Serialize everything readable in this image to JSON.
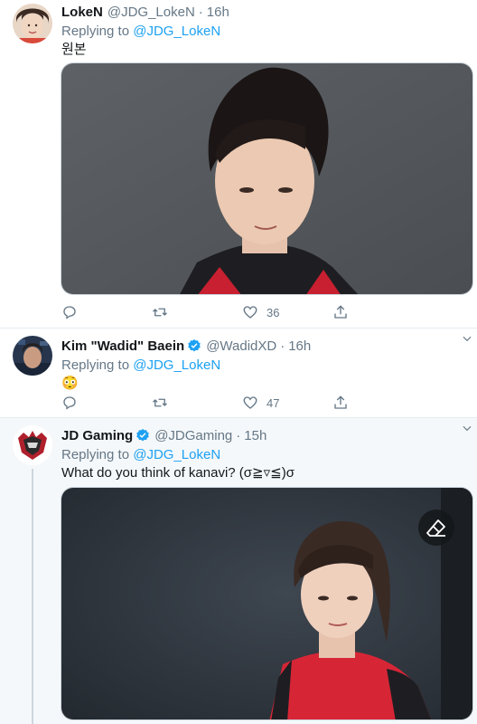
{
  "tweets": [
    {
      "display_name": "LokeN",
      "handle": "@JDG_LokeN",
      "time": "16h",
      "replying_label": "Replying to ",
      "replying_to": "@JDG_LokeN",
      "text": "원본",
      "verified": false,
      "actions": {
        "reply_count": "",
        "retweet_count": "",
        "like_count": "36"
      }
    },
    {
      "display_name": "Kim \"Wadid\" Baein",
      "handle": "@WadidXD",
      "time": "16h",
      "replying_label": "Replying to ",
      "replying_to": "@JDG_LokeN",
      "text": "😳",
      "verified": true,
      "actions": {
        "reply_count": "",
        "retweet_count": "",
        "like_count": "47"
      }
    },
    {
      "display_name": "JD Gaming",
      "handle": "@JDGaming",
      "time": "15h",
      "replying_label": "Replying to ",
      "replying_to": "@JDG_LokeN",
      "text": "What do you think of kanavi?  (σ≧▿≦)σ",
      "verified": true
    }
  ],
  "separator": "·",
  "colors": {
    "link": "#1da1f2",
    "secondary_text": "#657786",
    "verified": "#1da1f2",
    "border": "#e6ecf0",
    "highlight_bg": "#f5f8fa"
  },
  "icons": [
    "chevron-down-icon",
    "reply-icon",
    "retweet-icon",
    "like-icon",
    "share-icon",
    "verified-badge-icon",
    "eraser-icon"
  ]
}
